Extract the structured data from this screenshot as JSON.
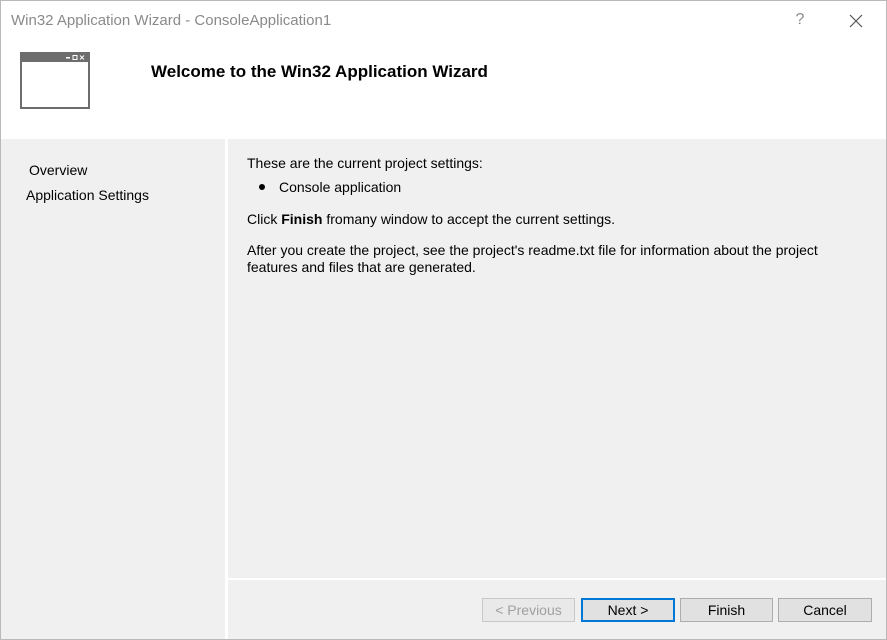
{
  "window": {
    "title": "Win32 Application Wizard - ConsoleApplication1",
    "help_glyph": "?"
  },
  "header": {
    "title": "Welcome to the Win32 Application Wizard",
    "icon": "window-icon"
  },
  "nav": {
    "items": [
      {
        "label": "Overview"
      },
      {
        "label": "Application Settings"
      }
    ]
  },
  "content": {
    "intro": "These are the current project settings:",
    "bullets": [
      "Console application"
    ],
    "finish_prefix": "Click ",
    "finish_bold": "Finish",
    "finish_suffix": " fromany window to accept the current settings.",
    "readme": "After you create the project, see the project's readme.txt file for information about the project features and files that are generated."
  },
  "buttons": {
    "previous": "< Previous",
    "next": "Next >",
    "finish": "Finish",
    "cancel": "Cancel"
  },
  "colors": {
    "accent": "#0078d7",
    "titlebar_text": "#8a8a8a",
    "panel_bg": "#f0f0f0"
  }
}
